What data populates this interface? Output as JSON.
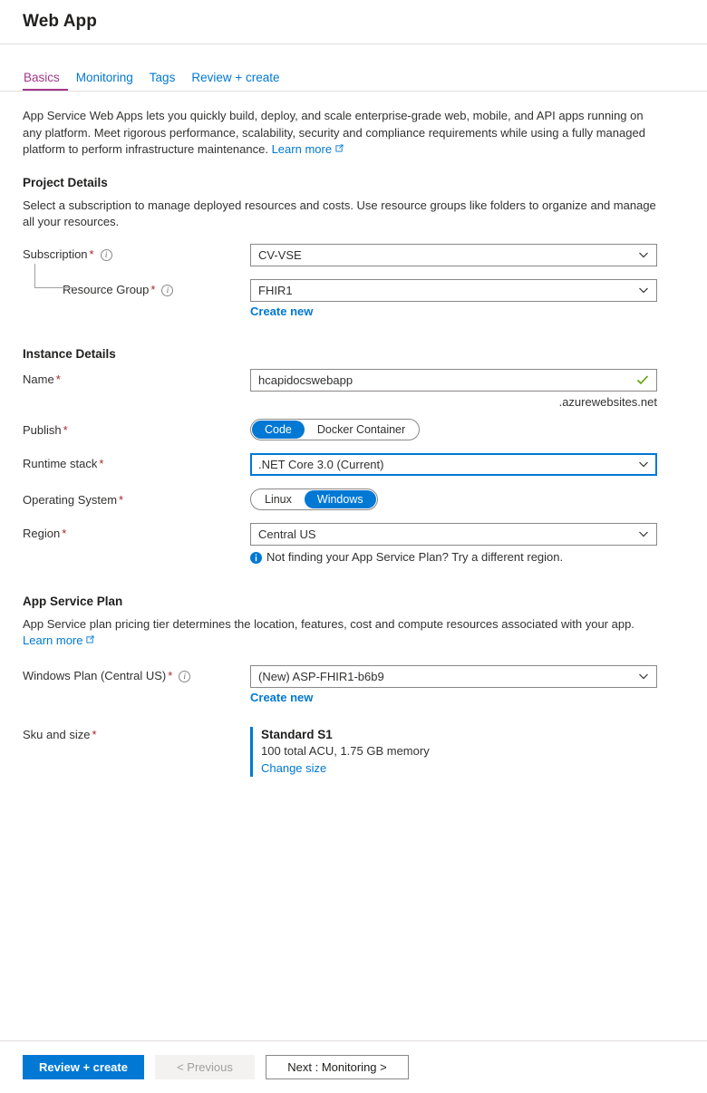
{
  "header": {
    "title": "Web App"
  },
  "tabs": [
    {
      "label": "Basics",
      "active": true
    },
    {
      "label": "Monitoring",
      "active": false
    },
    {
      "label": "Tags",
      "active": false
    },
    {
      "label": "Review + create",
      "active": false
    }
  ],
  "intro": {
    "text": "App Service Web Apps lets you quickly build, deploy, and scale enterprise-grade web, mobile, and API apps running on any platform. Meet rigorous performance, scalability, security and compliance requirements while using a fully managed platform to perform infrastructure maintenance.",
    "learn_more": "Learn more"
  },
  "project_details": {
    "heading": "Project Details",
    "description": "Select a subscription to manage deployed resources and costs. Use resource groups like folders to organize and manage all your resources.",
    "subscription": {
      "label": "Subscription",
      "required": "*",
      "value": "CV-VSE",
      "info_icon": "info-circle-icon"
    },
    "resource_group": {
      "label": "Resource Group",
      "required": "*",
      "value": "FHIR1",
      "create_new": "Create new",
      "info_icon": "info-circle-icon"
    }
  },
  "instance_details": {
    "heading": "Instance Details",
    "name": {
      "label": "Name",
      "required": "*",
      "value": "hcapidocswebapp",
      "suffix": ".azurewebsites.net",
      "valid_icon": "checkmark-icon"
    },
    "publish": {
      "label": "Publish",
      "required": "*",
      "options": [
        "Code",
        "Docker Container"
      ],
      "selected": "Code"
    },
    "runtime_stack": {
      "label": "Runtime stack",
      "required": "*",
      "value": ".NET Core 3.0 (Current)",
      "focused": true
    },
    "operating_system": {
      "label": "Operating System",
      "required": "*",
      "options": [
        "Linux",
        "Windows"
      ],
      "selected": "Windows"
    },
    "region": {
      "label": "Region",
      "required": "*",
      "value": "Central US",
      "note": "Not finding your App Service Plan? Try a different region.",
      "note_icon": "info-filled-icon"
    }
  },
  "app_service_plan": {
    "heading": "App Service Plan",
    "description": "App Service plan pricing tier determines the location, features, cost and compute resources associated with your app.",
    "learn_more": "Learn more",
    "windows_plan": {
      "label": "Windows Plan (Central US)",
      "required": "*",
      "value": "(New) ASP-FHIR1-b6b9",
      "create_new": "Create new",
      "info_icon": "info-circle-icon"
    },
    "sku": {
      "label": "Sku and size",
      "required": "*",
      "title": "Standard S1",
      "description": "100 total ACU, 1.75 GB memory",
      "change_link": "Change size"
    }
  },
  "footer": {
    "review_create": "Review + create",
    "previous": "< Previous",
    "next": "Next : Monitoring >"
  },
  "colors": {
    "accent_blue": "#0078d4",
    "active_tab": "#a4368b",
    "required_red": "#a4262c",
    "valid_green": "#5ca300"
  }
}
